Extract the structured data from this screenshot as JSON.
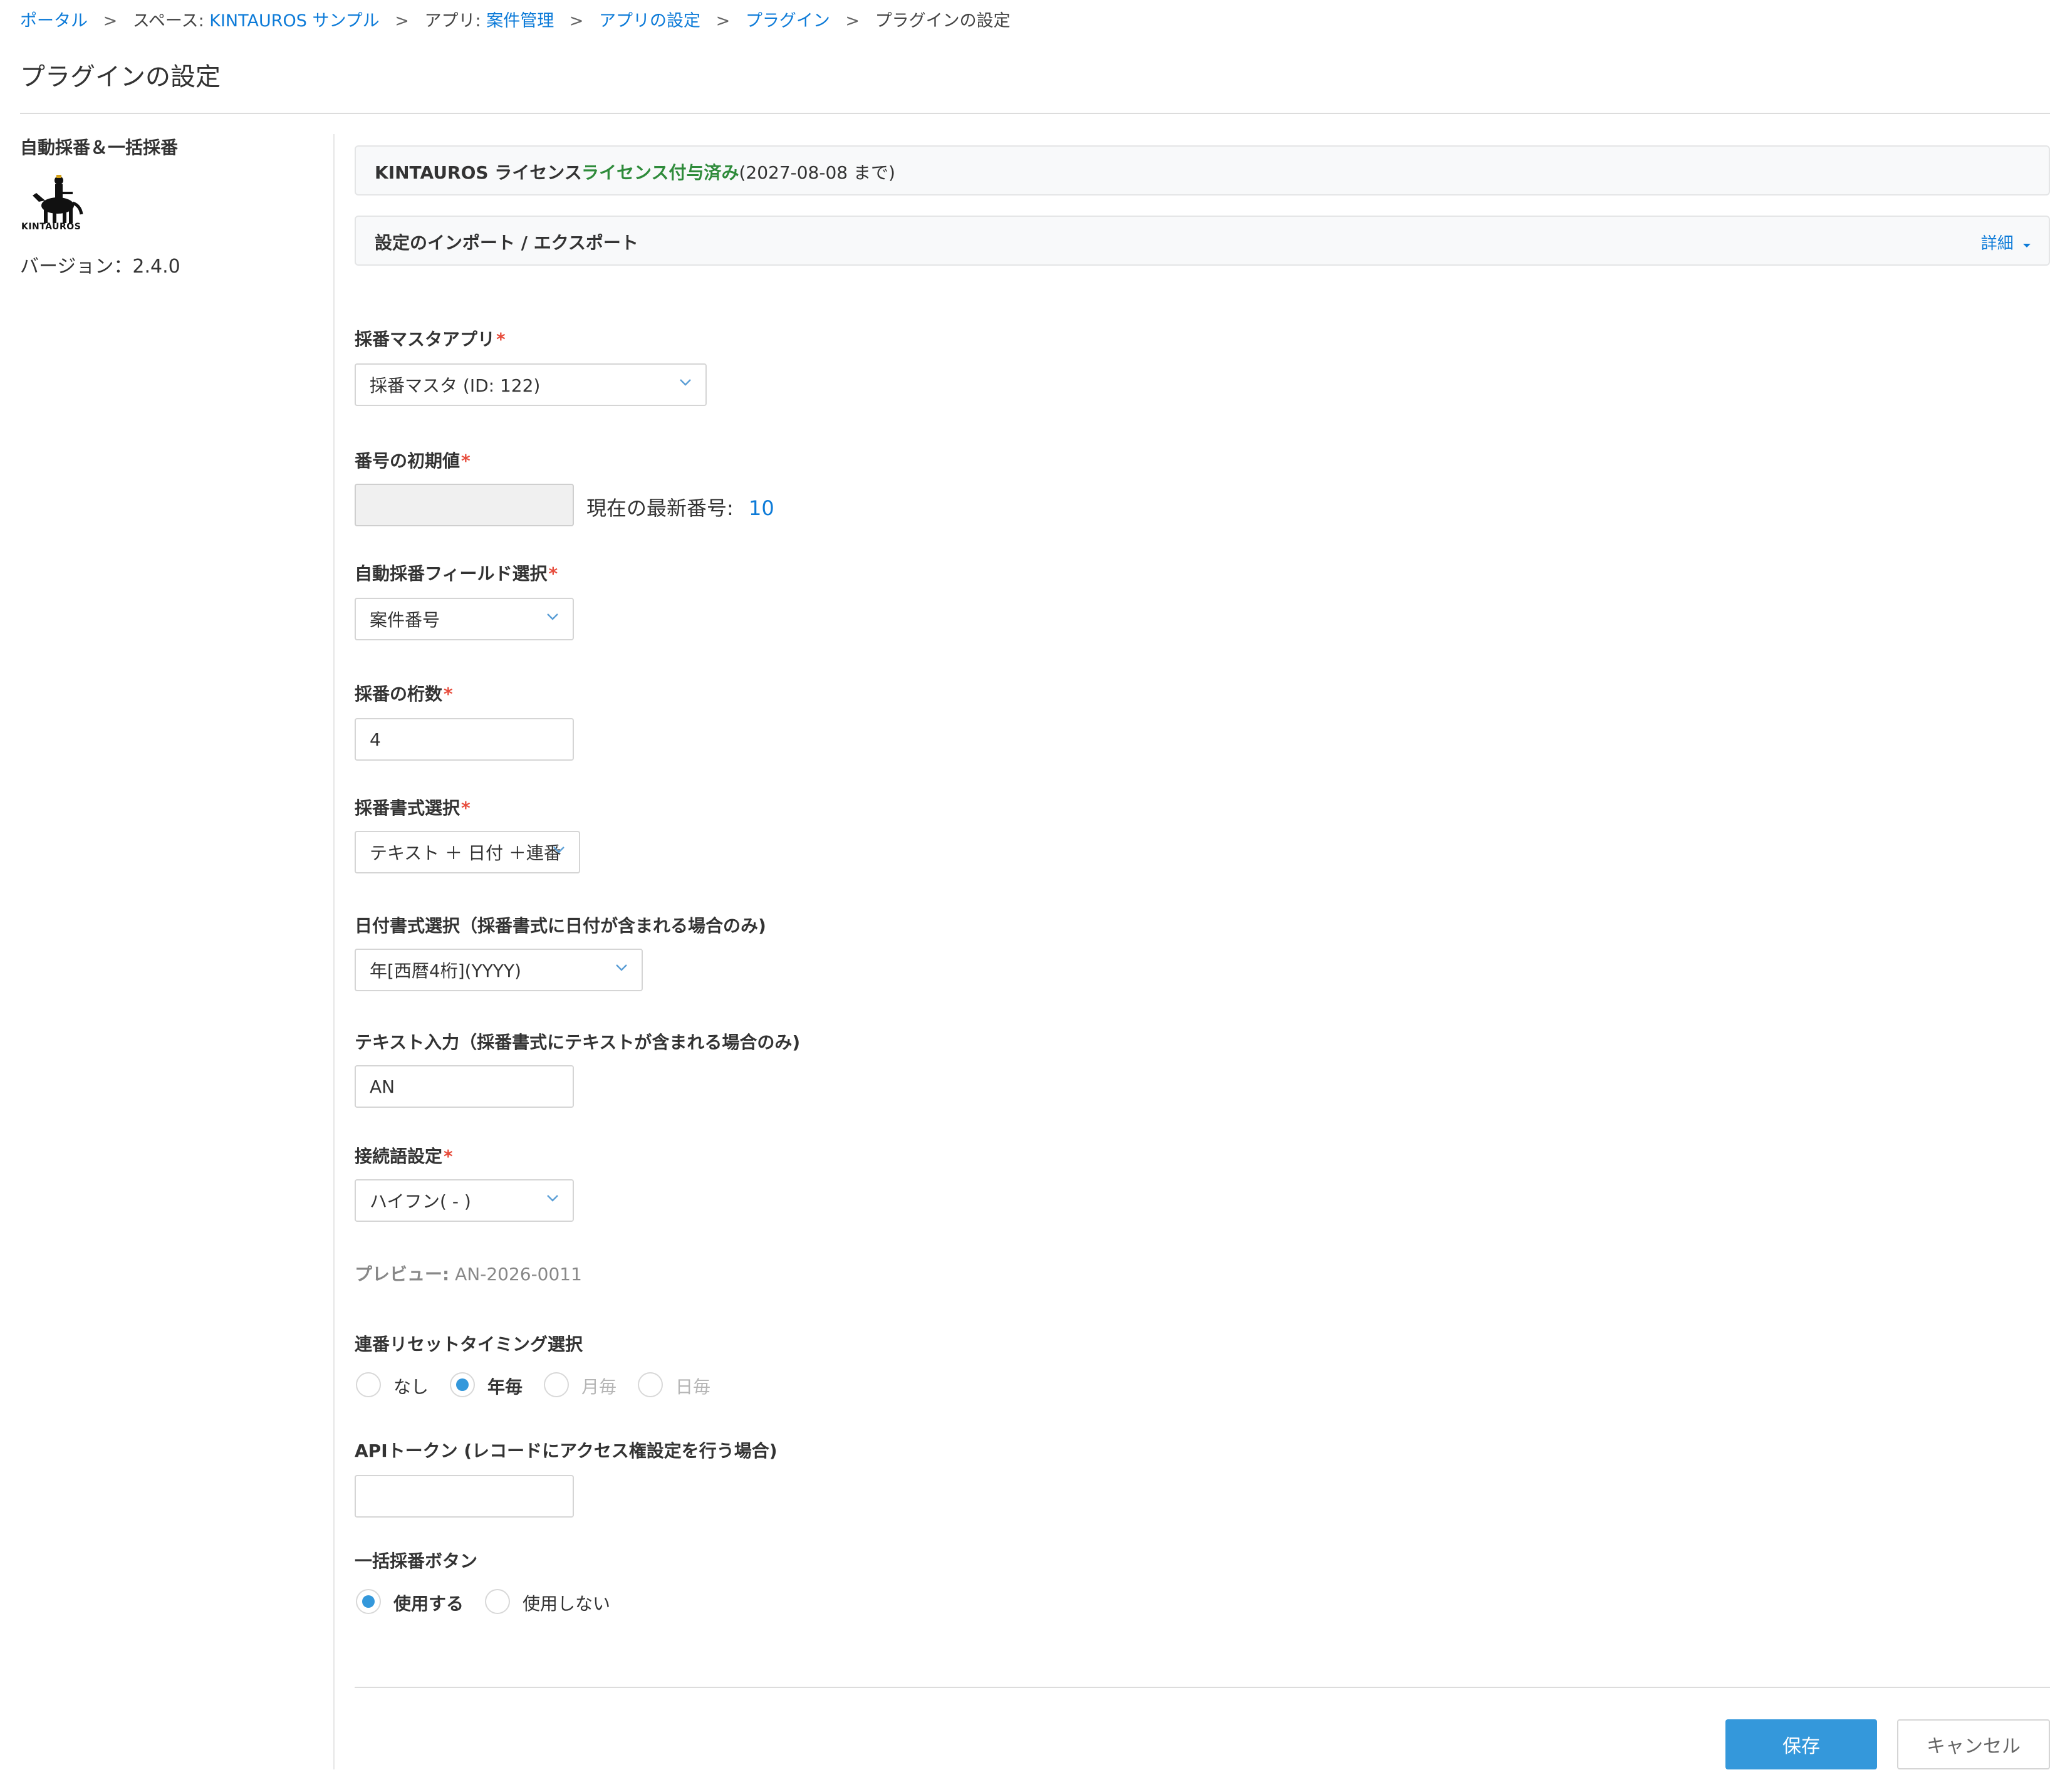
{
  "breadcrumb": {
    "portal": "ポータル",
    "sep": ">",
    "space_prefix": "スペース:",
    "space_name": "KINTAUROS サンプル",
    "app_prefix": "アプリ:",
    "app_name": "案件管理",
    "app_settings": "アプリの設定",
    "plugins": "プラグイン",
    "current": "プラグインの設定"
  },
  "page_title": "プラグインの設定",
  "sidebar": {
    "plugin_name": "自動採番＆一括採番",
    "logo_text": "KINTAUROS",
    "version": "バージョン：2.4.0"
  },
  "license": {
    "label": "KINTAUROS ライセンス",
    "status": "ライセンス付与済み",
    "expiry": "(2027-08-08 まで)"
  },
  "import_export": {
    "label": "設定のインポート / エクスポート",
    "details": "詳細"
  },
  "form": {
    "master_app": {
      "label": "採番マスタアプリ",
      "value": "採番マスタ (ID: 122)"
    },
    "initial_value": {
      "label": "番号の初期値",
      "value": "",
      "current_label": "現在の最新番号:",
      "current_value": "10"
    },
    "auto_field": {
      "label": "自動採番フィールド選択",
      "value": "案件番号"
    },
    "digits": {
      "label": "採番の桁数",
      "value": "4"
    },
    "format": {
      "label": "採番書式選択",
      "value": "テキスト ＋ 日付 ＋連番"
    },
    "date_format": {
      "label": "日付書式選択（採番書式に日付が含まれる場合のみ)",
      "value": "年[西暦4桁](YYYY)"
    },
    "text_input": {
      "label": "テキスト入力（採番書式にテキストが含まれる場合のみ)",
      "value": "AN"
    },
    "connector": {
      "label": "接続語設定",
      "value": "ハイフン( - )"
    },
    "preview": {
      "label": "プレビュー:",
      "value": "AN-2026-0011"
    },
    "reset_timing": {
      "label": "連番リセットタイミング選択",
      "options": [
        "なし",
        "年毎",
        "月毎",
        "日毎"
      ],
      "selected": "年毎"
    },
    "api_token": {
      "label": "APIトークン (レコードにアクセス権設定を行う場合)",
      "value": ""
    },
    "bulk_button": {
      "label": "一括採番ボタン",
      "options": [
        "使用する",
        "使用しない"
      ],
      "selected": "使用する"
    }
  },
  "actions": {
    "save": "保存",
    "cancel": "キャンセル"
  },
  "colors": {
    "link": "#0d7bd8",
    "license_ok": "#2e8b3a",
    "primary": "#3498db",
    "required": "#e74c3c"
  }
}
